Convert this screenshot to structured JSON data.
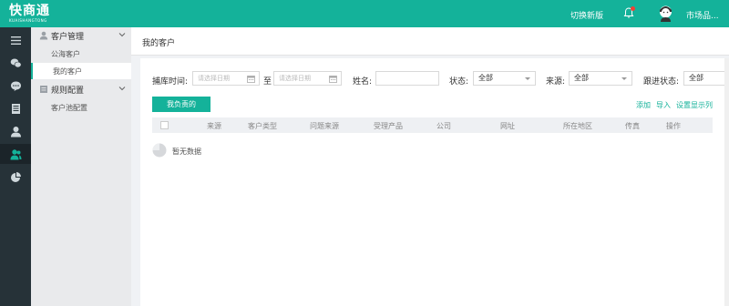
{
  "topbar": {
    "logo_main": "快商通",
    "logo_sub": "KUAISHANGTONG",
    "switch_label": "切换新版",
    "username": "市场品..."
  },
  "sidebar_icons": [
    {
      "name": "menu-icon"
    },
    {
      "name": "chat-icon"
    },
    {
      "name": "message-icon"
    },
    {
      "name": "list-icon"
    },
    {
      "name": "user-icon"
    },
    {
      "name": "customers-icon"
    },
    {
      "name": "pie-chart-icon"
    }
  ],
  "submenu": {
    "groups": [
      {
        "label": "客户管理",
        "items": [
          "公海客户",
          "我的客户"
        ]
      },
      {
        "label": "规则配置",
        "items": [
          "客户池配置"
        ]
      }
    ]
  },
  "page": {
    "title": "我的客户"
  },
  "filters": {
    "capture_time_label": "捕库时间:",
    "date_start_placeholder": "请选择日期",
    "to_label": "至",
    "date_end_placeholder": "请选择日期",
    "name_label": "姓名:",
    "name_value": "",
    "status_label": "状态:",
    "status_value": "全部",
    "source_label": "来源:",
    "source_value": "全部",
    "follow_label": "跟进状态:",
    "follow_value": "全部"
  },
  "actions": {
    "tab_label": "我负责的",
    "add_label": "添加",
    "import_label": "导入",
    "columns_label": "设置显示列"
  },
  "table": {
    "columns": [
      "来源",
      "客户类型",
      "问题来源",
      "受理产品",
      "公司",
      "网址",
      "所在地区",
      "传真",
      "操作"
    ],
    "rows": [],
    "empty_text": "暂无数据"
  },
  "colors": {
    "accent": "#14b29a",
    "sidebar": "#263238"
  }
}
